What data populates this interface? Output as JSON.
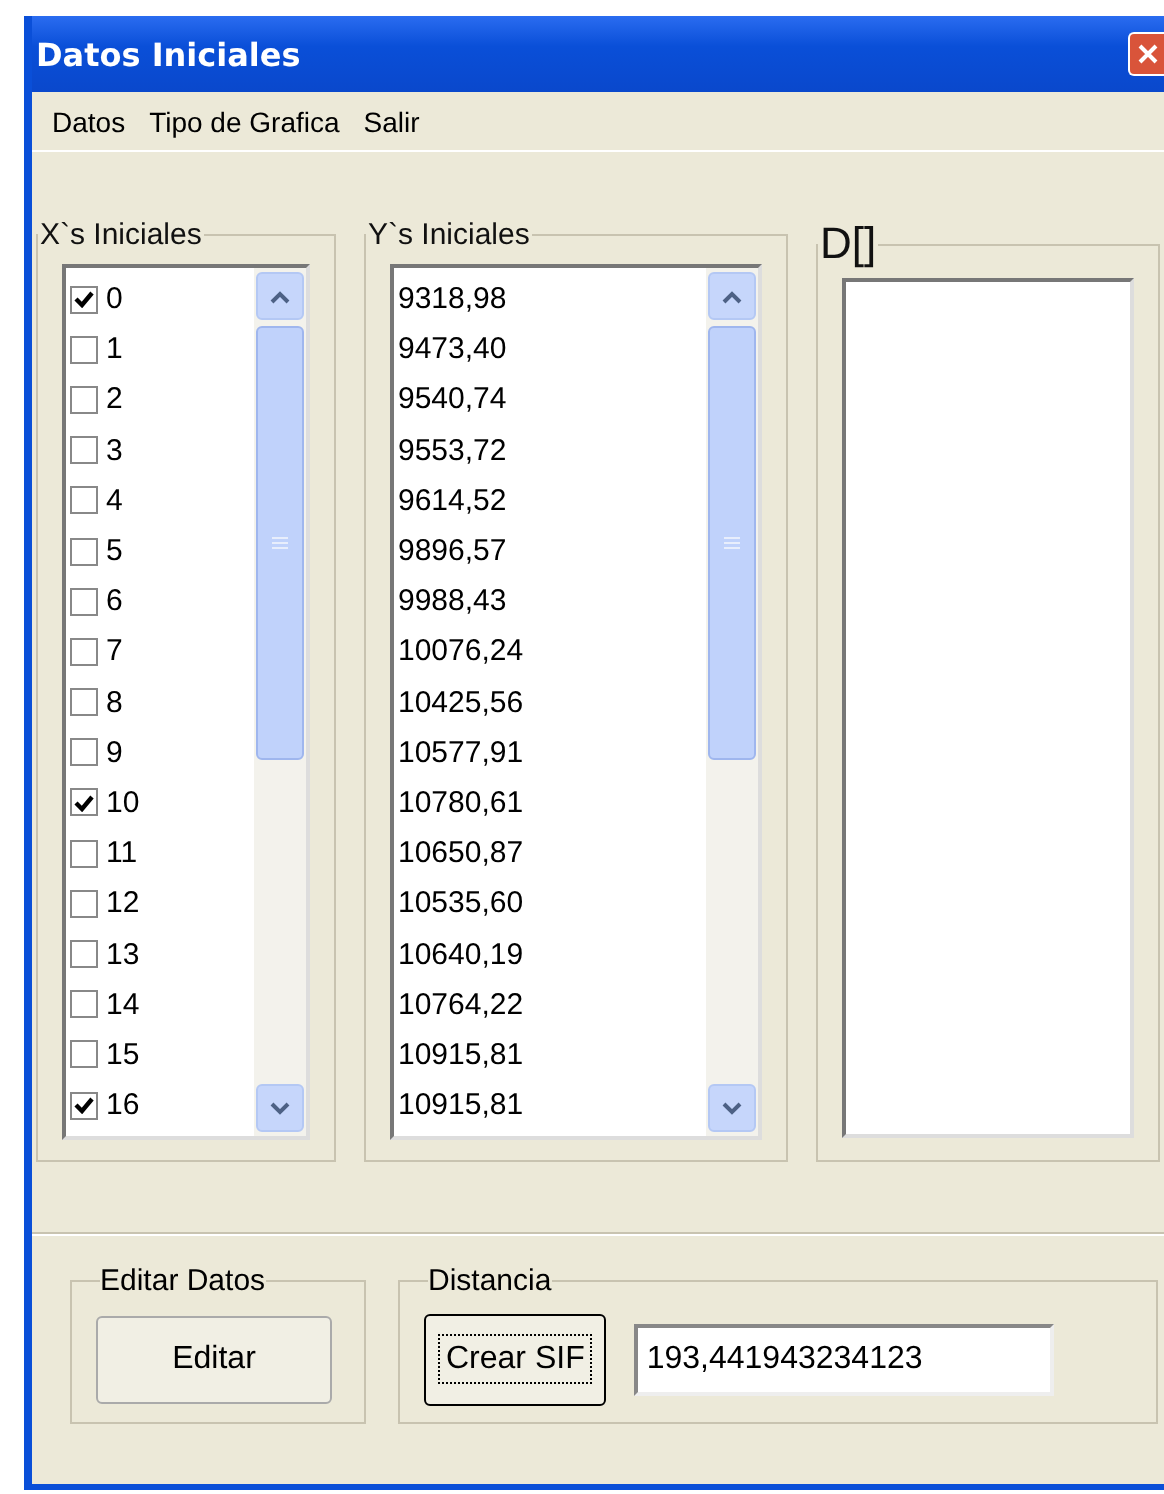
{
  "window": {
    "title": "Datos Iniciales"
  },
  "menu": [
    "Datos",
    "Tipo de Grafica",
    "Salir"
  ],
  "x_group": {
    "title": "X`s Iniciales",
    "items": [
      {
        "label": "0",
        "checked": true
      },
      {
        "label": "1",
        "checked": false
      },
      {
        "label": "2",
        "checked": false
      },
      {
        "label": "3",
        "checked": false
      },
      {
        "label": "4",
        "checked": false
      },
      {
        "label": "5",
        "checked": false
      },
      {
        "label": "6",
        "checked": false
      },
      {
        "label": "7",
        "checked": false
      },
      {
        "label": "8",
        "checked": false
      },
      {
        "label": "9",
        "checked": false
      },
      {
        "label": "10",
        "checked": true
      },
      {
        "label": "11",
        "checked": false
      },
      {
        "label": "12",
        "checked": false
      },
      {
        "label": "13",
        "checked": false
      },
      {
        "label": "14",
        "checked": false
      },
      {
        "label": "15",
        "checked": false
      },
      {
        "label": "16",
        "checked": true
      }
    ]
  },
  "y_group": {
    "title": "Y`s Iniciales",
    "items": [
      "9318,98",
      "9473,40",
      "9540,74",
      "9553,72",
      "9614,52",
      "9896,57",
      "9988,43",
      "10076,24",
      "10425,56",
      "10577,91",
      "10780,61",
      "10650,87",
      "10535,60",
      "10640,19",
      "10764,22",
      "10915,81",
      "10915,81"
    ]
  },
  "d_group": {
    "title": "D[]"
  },
  "edit_group": {
    "title": "Editar Datos",
    "button": "Editar"
  },
  "distance_group": {
    "title": "Distancia",
    "button": "Crear SIF",
    "value": "193,441943234123"
  }
}
